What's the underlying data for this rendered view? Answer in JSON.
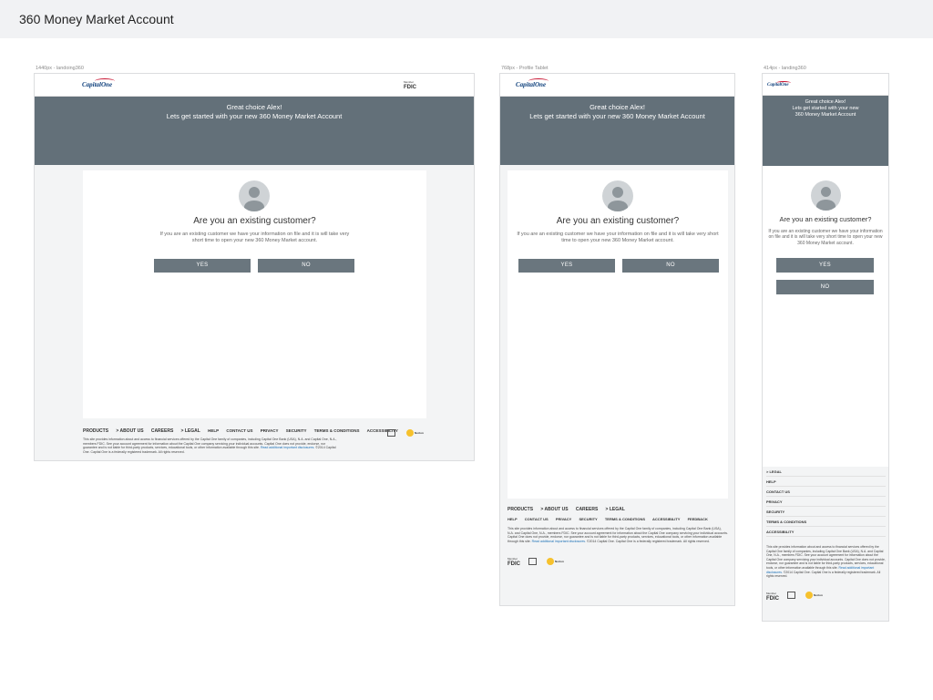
{
  "page_title": "360 Money Market Account",
  "frames": [
    {
      "label": "1440px - landoing360"
    },
    {
      "label": "768px - Profile Tablet"
    },
    {
      "label": "414px - landing360"
    }
  ],
  "brand": {
    "logo_text": "CapitalOne",
    "fdic_top": "Member",
    "fdic_main": "FDIC"
  },
  "hero": {
    "line1": "Great choice Alex!",
    "line2": "Lets get started with your new  360 Money Market Account"
  },
  "hero_mobile": {
    "line1": "Great choice Alex!",
    "line2": "Lets get started with your new",
    "line3": "360 Money Market Account"
  },
  "question": "Are you an existing customer?",
  "description": "If you are an existing customer we have your information on file and it is will take very short time to open your new 360 Money Market account.",
  "buttons": {
    "yes": "YES",
    "no": "NO"
  },
  "footer": {
    "primary": [
      "PRODUCTS",
      "> ABOUT US",
      "CAREERS",
      "> LEGAL"
    ],
    "secondary": [
      "HELP",
      "CONTACT US",
      "PRIVACY",
      "SECURITY",
      "TERMS & CONDITIONS",
      "ACCESSIBILITY"
    ],
    "secondary_tablet": [
      "HELP",
      "CONTACT US",
      "PRIVACY",
      "SECURITY",
      "TERMS & CONDITIONS",
      "ACCESSIBILITY",
      "FEEDBACK"
    ],
    "mobile_nav": [
      "> LEGAL",
      "HELP",
      "CONTACT US",
      "PRIVACY",
      "SECURITY",
      "TERMS & CONDITIONS",
      "ACCESSIBILITY"
    ],
    "legal_text": "This site provides information about and access to financial services offered by the Capital One family of companies, including Capital One Bank (USA), N.A. and Capital One, N.A., members FDIC. See your account agreement for information about the Capital One company servicing your individual accounts. Capital One does not provide, endorse, nor guarantee and is not liable for third-party products, services, educational tools, or other information available through this site.",
    "legal_link": "Read additional important disclosures.",
    "legal_tail": "©2014 Capital One. Capital One is a federally registered trademark. All rights reserved.",
    "norton": "Norton"
  },
  "colors": {
    "hero": "#637079",
    "button": "#6a767e",
    "link": "#1a6fb5",
    "brand_red": "#c8102e",
    "brand_blue": "#0b3d7a"
  }
}
